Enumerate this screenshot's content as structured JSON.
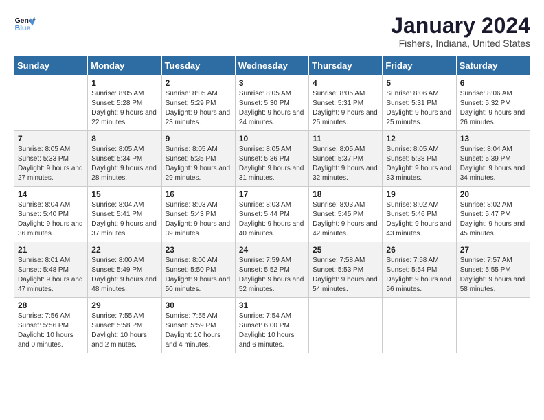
{
  "logo": {
    "line1": "General",
    "line2": "Blue"
  },
  "title": "January 2024",
  "location": "Fishers, Indiana, United States",
  "days_of_week": [
    "Sunday",
    "Monday",
    "Tuesday",
    "Wednesday",
    "Thursday",
    "Friday",
    "Saturday"
  ],
  "weeks": [
    [
      {
        "day": "",
        "sunrise": "",
        "sunset": "",
        "daylight": ""
      },
      {
        "day": "1",
        "sunrise": "8:05 AM",
        "sunset": "5:28 PM",
        "daylight": "9 hours and 22 minutes."
      },
      {
        "day": "2",
        "sunrise": "8:05 AM",
        "sunset": "5:29 PM",
        "daylight": "9 hours and 23 minutes."
      },
      {
        "day": "3",
        "sunrise": "8:05 AM",
        "sunset": "5:30 PM",
        "daylight": "9 hours and 24 minutes."
      },
      {
        "day": "4",
        "sunrise": "8:05 AM",
        "sunset": "5:31 PM",
        "daylight": "9 hours and 25 minutes."
      },
      {
        "day": "5",
        "sunrise": "8:06 AM",
        "sunset": "5:31 PM",
        "daylight": "9 hours and 25 minutes."
      },
      {
        "day": "6",
        "sunrise": "8:06 AM",
        "sunset": "5:32 PM",
        "daylight": "9 hours and 26 minutes."
      }
    ],
    [
      {
        "day": "7",
        "sunrise": "8:05 AM",
        "sunset": "5:33 PM",
        "daylight": "9 hours and 27 minutes."
      },
      {
        "day": "8",
        "sunrise": "8:05 AM",
        "sunset": "5:34 PM",
        "daylight": "9 hours and 28 minutes."
      },
      {
        "day": "9",
        "sunrise": "8:05 AM",
        "sunset": "5:35 PM",
        "daylight": "9 hours and 29 minutes."
      },
      {
        "day": "10",
        "sunrise": "8:05 AM",
        "sunset": "5:36 PM",
        "daylight": "9 hours and 31 minutes."
      },
      {
        "day": "11",
        "sunrise": "8:05 AM",
        "sunset": "5:37 PM",
        "daylight": "9 hours and 32 minutes."
      },
      {
        "day": "12",
        "sunrise": "8:05 AM",
        "sunset": "5:38 PM",
        "daylight": "9 hours and 33 minutes."
      },
      {
        "day": "13",
        "sunrise": "8:04 AM",
        "sunset": "5:39 PM",
        "daylight": "9 hours and 34 minutes."
      }
    ],
    [
      {
        "day": "14",
        "sunrise": "8:04 AM",
        "sunset": "5:40 PM",
        "daylight": "9 hours and 36 minutes."
      },
      {
        "day": "15",
        "sunrise": "8:04 AM",
        "sunset": "5:41 PM",
        "daylight": "9 hours and 37 minutes."
      },
      {
        "day": "16",
        "sunrise": "8:03 AM",
        "sunset": "5:43 PM",
        "daylight": "9 hours and 39 minutes."
      },
      {
        "day": "17",
        "sunrise": "8:03 AM",
        "sunset": "5:44 PM",
        "daylight": "9 hours and 40 minutes."
      },
      {
        "day": "18",
        "sunrise": "8:03 AM",
        "sunset": "5:45 PM",
        "daylight": "9 hours and 42 minutes."
      },
      {
        "day": "19",
        "sunrise": "8:02 AM",
        "sunset": "5:46 PM",
        "daylight": "9 hours and 43 minutes."
      },
      {
        "day": "20",
        "sunrise": "8:02 AM",
        "sunset": "5:47 PM",
        "daylight": "9 hours and 45 minutes."
      }
    ],
    [
      {
        "day": "21",
        "sunrise": "8:01 AM",
        "sunset": "5:48 PM",
        "daylight": "9 hours and 47 minutes."
      },
      {
        "day": "22",
        "sunrise": "8:00 AM",
        "sunset": "5:49 PM",
        "daylight": "9 hours and 48 minutes."
      },
      {
        "day": "23",
        "sunrise": "8:00 AM",
        "sunset": "5:50 PM",
        "daylight": "9 hours and 50 minutes."
      },
      {
        "day": "24",
        "sunrise": "7:59 AM",
        "sunset": "5:52 PM",
        "daylight": "9 hours and 52 minutes."
      },
      {
        "day": "25",
        "sunrise": "7:58 AM",
        "sunset": "5:53 PM",
        "daylight": "9 hours and 54 minutes."
      },
      {
        "day": "26",
        "sunrise": "7:58 AM",
        "sunset": "5:54 PM",
        "daylight": "9 hours and 56 minutes."
      },
      {
        "day": "27",
        "sunrise": "7:57 AM",
        "sunset": "5:55 PM",
        "daylight": "9 hours and 58 minutes."
      }
    ],
    [
      {
        "day": "28",
        "sunrise": "7:56 AM",
        "sunset": "5:56 PM",
        "daylight": "10 hours and 0 minutes."
      },
      {
        "day": "29",
        "sunrise": "7:55 AM",
        "sunset": "5:58 PM",
        "daylight": "10 hours and 2 minutes."
      },
      {
        "day": "30",
        "sunrise": "7:55 AM",
        "sunset": "5:59 PM",
        "daylight": "10 hours and 4 minutes."
      },
      {
        "day": "31",
        "sunrise": "7:54 AM",
        "sunset": "6:00 PM",
        "daylight": "10 hours and 6 minutes."
      },
      {
        "day": "",
        "sunrise": "",
        "sunset": "",
        "daylight": ""
      },
      {
        "day": "",
        "sunrise": "",
        "sunset": "",
        "daylight": ""
      },
      {
        "day": "",
        "sunrise": "",
        "sunset": "",
        "daylight": ""
      }
    ]
  ]
}
